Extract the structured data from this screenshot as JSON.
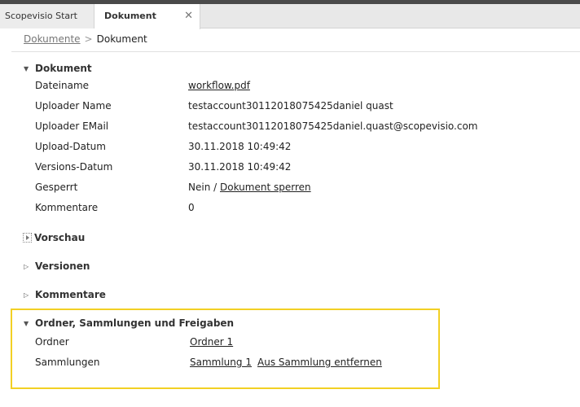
{
  "tabs": [
    {
      "label": "Scopevisio Start"
    },
    {
      "label": "Dokument",
      "close": "✕"
    }
  ],
  "breadcrumb": {
    "parent": "Dokumente",
    "separator": ">",
    "current": "Dokument"
  },
  "sections": {
    "dokument": {
      "title": "Dokument",
      "rows": [
        {
          "label": "Dateiname",
          "value": "workflow.pdf"
        },
        {
          "label": "Uploader Name",
          "value": "testaccount30112018075425daniel quast"
        },
        {
          "label": "Uploader EMail",
          "value": "testaccount30112018075425daniel.quast@scopevisio.com"
        },
        {
          "label": "Upload-Datum",
          "value": "30.11.2018 10:49:42"
        },
        {
          "label": "Versions-Datum",
          "value": "30.11.2018 10:49:42"
        },
        {
          "label": "Gesperrt",
          "value": "Nein",
          "separator": "/",
          "action": "Dokument sperren"
        },
        {
          "label": "Kommentare",
          "value": "0"
        }
      ]
    },
    "vorschau": {
      "title": "Vorschau"
    },
    "versionen": {
      "title": "Versionen"
    },
    "kommentare": {
      "title": "Kommentare"
    },
    "ordner": {
      "title": "Ordner, Sammlungen und Freigaben",
      "rows": [
        {
          "label": "Ordner",
          "value": "Ordner 1"
        },
        {
          "label": "Sammlungen",
          "value": "Sammlung 1",
          "action": "Aus Sammlung entfernen"
        }
      ]
    }
  },
  "icons": {
    "expanded": "▼",
    "collapsed": "▷"
  },
  "colors": {
    "highlight": "#f2d024",
    "topbar": "#4a4a4a"
  }
}
